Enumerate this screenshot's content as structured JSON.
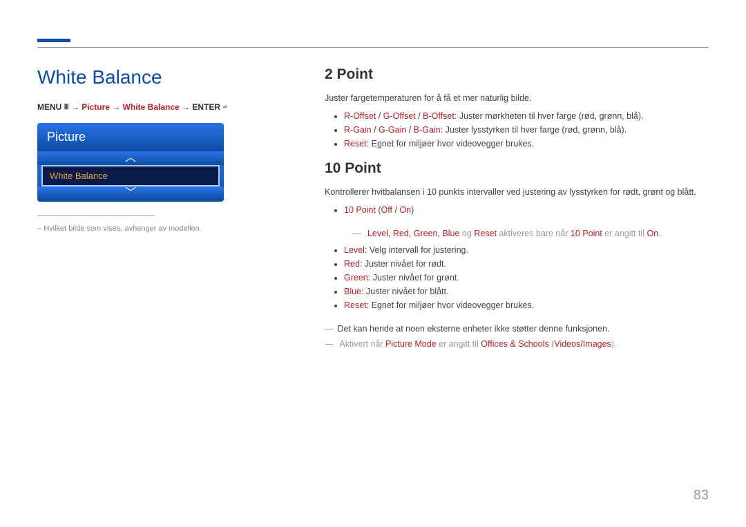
{
  "page_number": "83",
  "left": {
    "title": "White Balance",
    "breadcrumb": {
      "menu": "MENU",
      "menu_icon": "Ⅲ",
      "sep": " → ",
      "picture": "Picture",
      "wb": "White Balance",
      "enter": "ENTER",
      "enter_icon": "⏎"
    },
    "widget": {
      "header": "Picture",
      "item": "White Balance"
    },
    "note": "Hvilket bilde som vises, avhenger av modellen."
  },
  "right": {
    "s1": {
      "title": "2 Point",
      "intro": "Juster fargetemperaturen for å få et mer naturlig bilde.",
      "b1": {
        "r": "R-Offset",
        "g": "G-Offset",
        "b": "B-Offset",
        "rest": ": Juster mørkheten til hver farge (rød, grønn, blå)."
      },
      "b2": {
        "r": "R-Gain",
        "g": "G-Gain",
        "b": "B-Gain",
        "rest": ": Juster lysstyrken til hver farge (rød, grønn, blå)."
      },
      "b3": {
        "k": "Reset",
        "rest": ": Egnet for miljøer hvor videovegger brukes."
      }
    },
    "s2": {
      "title": "10 Point",
      "intro": "Kontrollerer hvitbalansen i 10 punkts intervaller ved justering av lysstyrken for rødt, grønt og blått.",
      "b1": {
        "k": "10 Point",
        "open": " (",
        "off": "Off",
        "sep": " / ",
        "on": "On",
        "close": ")"
      },
      "note1": {
        "level": "Level",
        "red": "Red",
        "green": "Green",
        "blue": "Blue",
        "og": " og ",
        "reset": "Reset",
        "mid": " aktiveres bare når ",
        "tp": "10 Point",
        "mid2": " er angitt til ",
        "on": "On",
        "end": "."
      },
      "b2": {
        "k": "Level",
        "rest": ": Velg intervall for justering."
      },
      "b3": {
        "k": "Red",
        "rest": ": Juster nivået for rødt."
      },
      "b4": {
        "k": "Green",
        "rest": ": Juster nivået for grønt."
      },
      "b5": {
        "k": "Blue",
        "rest": ": Juster nivået for blått."
      },
      "b6": {
        "k": "Reset",
        "rest": ": Egnet for miljøer hvor videovegger brukes."
      },
      "note2": "Det kan hende at noen eksterne enheter ikke støtter denne funksjonen.",
      "note3": {
        "pre": "Aktivert når ",
        "pm": "Picture Mode",
        "mid": " er angitt til ",
        "os": "Offices & Schools",
        "open": " (",
        "vi": "Videos/Images",
        "close": ")."
      }
    }
  }
}
